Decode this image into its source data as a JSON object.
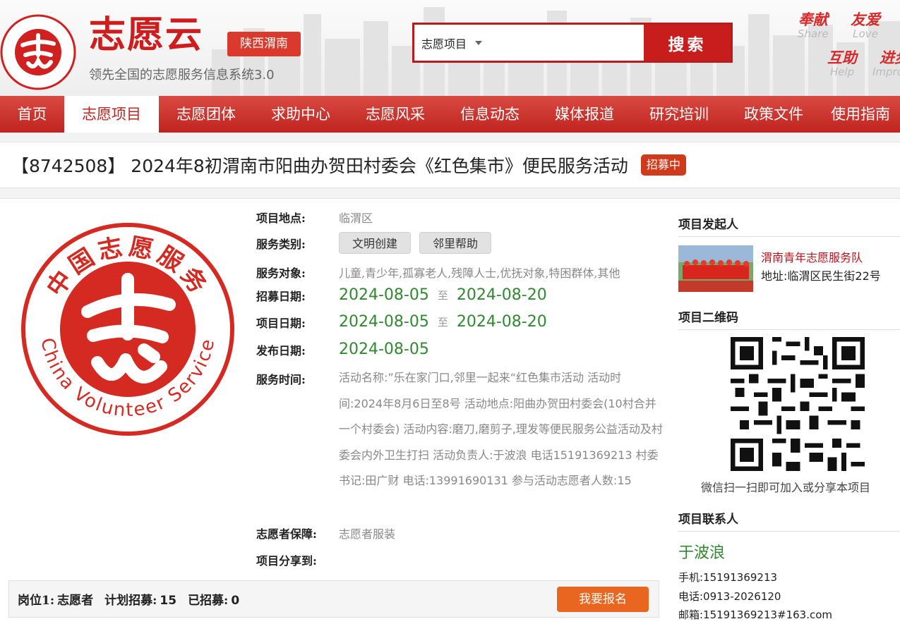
{
  "brand": {
    "logo_cn": "中国志愿服务",
    "logo_en": "CHINA VOLUNTEER SERVICE",
    "name": "志愿云",
    "region": "陕西渭南",
    "slogan": "领先全国的志愿服务信息系统3.0"
  },
  "search": {
    "category": "志愿项目",
    "button": "搜索"
  },
  "mottos": [
    {
      "cn": "奉献",
      "en": "Share"
    },
    {
      "cn": "友爱",
      "en": "Love"
    },
    {
      "cn": "互助",
      "en": "Help"
    },
    {
      "cn": "进步",
      "en": "Improve"
    }
  ],
  "nav": {
    "items": [
      "首页",
      "志愿项目",
      "志愿团体",
      "求助中心",
      "志愿风采",
      "信息动态",
      "媒体报道",
      "研究培训",
      "政策文件",
      "使用指南"
    ],
    "active_index": 1
  },
  "project": {
    "title": "【8742508】 2024年8初渭南市阳曲办贺田村委会《红色集市》便民服务活动",
    "status": "招募中",
    "labels": {
      "location": "项目地点:",
      "category": "服务类别:",
      "target": "服务对象:",
      "recruit": "招募日期:",
      "project": "项目日期:",
      "publish": "发布日期:",
      "time": "服务时间:",
      "guarantee": "志愿者保障:",
      "share": "项目分享到:"
    },
    "location": "临渭区",
    "tags": [
      "文明创建",
      "邻里帮助"
    ],
    "target": "儿童,青少年,孤寡老人,残障人士,优抚对象,特困群体,其他",
    "recruit_start": "2024-08-05",
    "recruit_end": "2024-08-20",
    "project_start": "2024-08-05",
    "project_end": "2024-08-20",
    "to": "至",
    "publish_date": "2024-08-05",
    "description": "活动名称:”乐在家门口,邻里一起来“红色集市活动 活动时间:2024年8月6日至8号 活动地点:阳曲办贺田村委会(10村合并一个村委会) 活动内容:磨刀,磨剪子,理发等便民服务公益活动及村委会内外卫生打扫 活动负责人:于波浪 电话15191369213 村委书记:田广财 电话:13991690131 参与活动志愿者人数:15",
    "guarantee": "志愿者服装"
  },
  "big_logo": {
    "cn": "中国志愿服务",
    "en": "China Volunteer Service"
  },
  "post": {
    "position_label": "岗位1:",
    "position_name": "志愿者",
    "plan_label": "计划招募:",
    "plan_count": "15",
    "joined_label": "已招募:",
    "joined_count": "0",
    "signup_button": "我要报名"
  },
  "sidebar": {
    "initiator_title": "项目发起人",
    "org_name": "渭南青年志愿服务队",
    "org_address": "地址:临渭区民生街22号",
    "qr_title": "项目二维码",
    "qr_caption": "微信扫一扫即可加入或分享本项目",
    "contact_title": "项目联系人",
    "contact_name": "于波浪",
    "mobile": "手机:15191369213",
    "phone": "电话:0913-2026120",
    "email": "邮箱:15191369213#163.com"
  },
  "colors": {
    "brand_red": "#c0241f",
    "date_green": "#2f8a2f",
    "signup_orange": "#e8661f"
  }
}
